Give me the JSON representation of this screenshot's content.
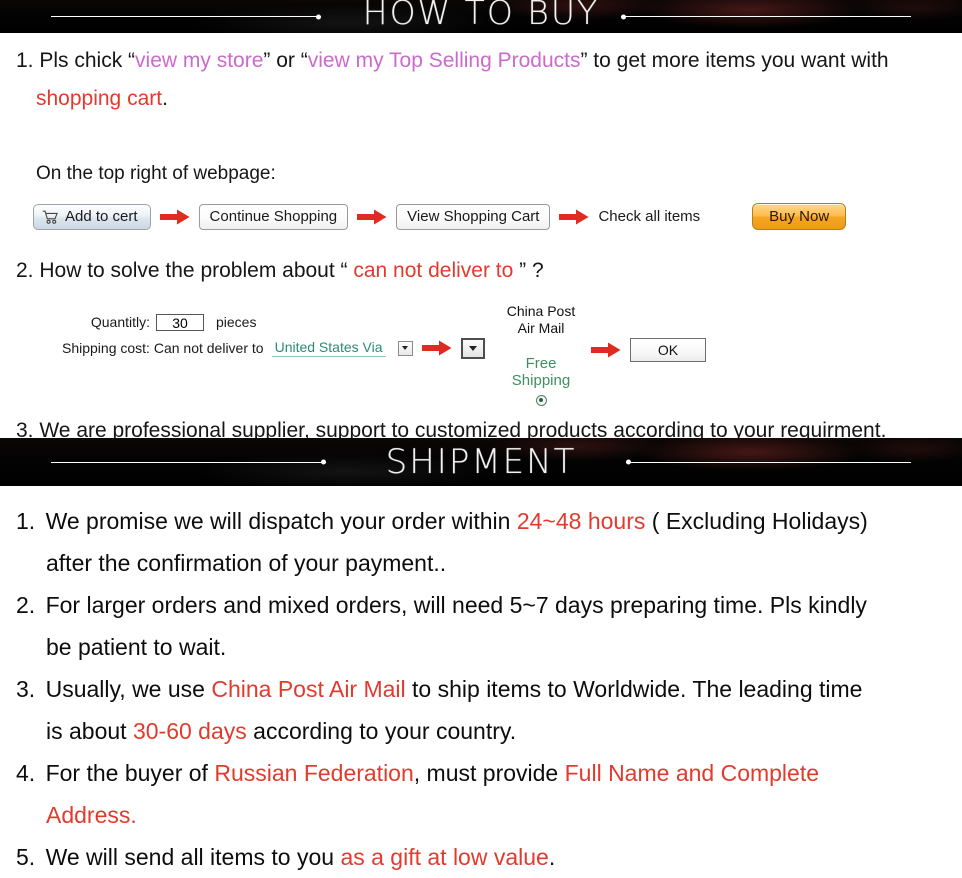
{
  "banners": {
    "how_to_buy": "HOW TO BUY",
    "shipment": "SHIPMENT"
  },
  "colors": {
    "magenta_link": "#cc6acc",
    "red_highlight": "#e23b2e",
    "teal_link": "#2e8b74",
    "green_free": "#3f8f5f",
    "banner_bg": "#050505",
    "buy_now_orange": "#f5a623"
  },
  "how_to_buy": {
    "item1": {
      "number": "1.",
      "lead": "Pls chick “",
      "link1": "view my store",
      "mid": "” or “",
      "link2": "view my Top Selling  Products",
      "tail": "” to get more items you want with",
      "cont_red": "shopping cart",
      "cont_tail": "."
    },
    "subheading": "On the top right of webpage:",
    "buttons": {
      "add_to_cart": "Add to cert",
      "cart_icon": "shopping-cart-icon",
      "continue_shopping": "Continue Shopping",
      "view_shopping_cart": "View Shopping Cart",
      "check_all_items": "Check all items",
      "buy_now": "Buy Now",
      "arrow_icon": "red-arrow-right-icon"
    },
    "item2": {
      "number": "2.",
      "lead": "How to solve the problem about “ ",
      "red": "can not deliver to",
      "tail": " ” ?"
    },
    "form": {
      "quantity_label": "Quantitly:",
      "quantity_value": "30",
      "quantity_unit": "pieces",
      "shipping_label": "Shipping cost: Can not deliver to",
      "country_link": "United States Via",
      "dropdown_small_icon": "chevron-down-icon",
      "dropdown_large_icon": "chevron-down-icon",
      "arrow_icon": "red-arrow-right-icon"
    },
    "shipping_option": {
      "carrier_line1": "China Post",
      "carrier_line2": "Air Mail",
      "free_line1": "Free",
      "free_line2": "Shipping",
      "radio_icon": "radio-selected-icon",
      "ok_button": "OK",
      "arrow_icon": "red-arrow-right-icon"
    },
    "item3": {
      "number": "3.",
      "text": "We are professional supplier, support to customized products according to your requirment."
    }
  },
  "shipment": {
    "items": [
      {
        "number": "1.",
        "parts": [
          {
            "text": "We promise we will dispatch your order within ",
            "color": "black"
          },
          {
            "text": "24~48 hours",
            "color": "red"
          },
          {
            "text": " ( Excluding Holidays)",
            "color": "black"
          }
        ],
        "second_line": [
          {
            "text": "after the confirmation of your payment..",
            "color": "black"
          }
        ]
      },
      {
        "number": "2.",
        "parts": [
          {
            "text": "For larger orders and mixed orders, will need 5~7 days preparing time. Pls kindly",
            "color": "black"
          }
        ],
        "second_line": [
          {
            "text": "be patient to wait.",
            "color": "black"
          }
        ]
      },
      {
        "number": "3.",
        "parts": [
          {
            "text": "Usually, we use ",
            "color": "black"
          },
          {
            "text": "China Post Air Mail",
            "color": "red"
          },
          {
            "text": " to ship items to Worldwide. The leading time",
            "color": "black"
          }
        ],
        "second_line": [
          {
            "text": "is about ",
            "color": "black"
          },
          {
            "text": "30-60 days",
            "color": "red"
          },
          {
            "text": " according to your country.",
            "color": "black"
          }
        ]
      },
      {
        "number": "4.",
        "parts": [
          {
            "text": "For the buyer of ",
            "color": "black"
          },
          {
            "text": "Russian Federation",
            "color": "red"
          },
          {
            "text": ", must provide ",
            "color": "black"
          },
          {
            "text": "Full Name and Complete",
            "color": "red"
          }
        ],
        "second_line": [
          {
            "text": "Address.",
            "color": "red"
          }
        ]
      },
      {
        "number": "5.",
        "parts": [
          {
            "text": "We will send all items to you ",
            "color": "black"
          },
          {
            "text": "as a gift at low value",
            "color": "red"
          },
          {
            "text": ".",
            "color": "black"
          }
        ],
        "second_line": []
      }
    ]
  }
}
